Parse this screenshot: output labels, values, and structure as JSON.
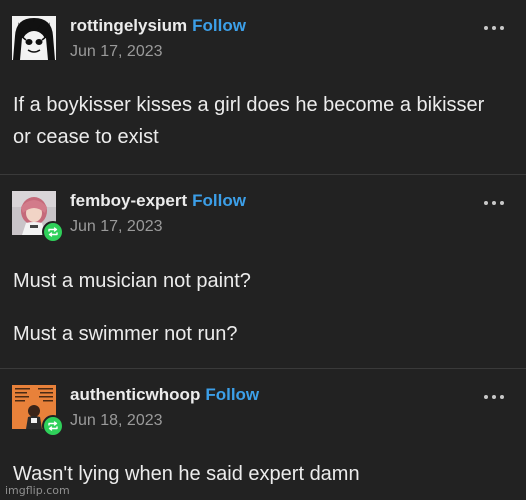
{
  "posts": [
    {
      "username": "rottingelysium",
      "follow_label": "Follow",
      "date": "Jun 17, 2023",
      "paragraphs": [
        "If a boykisser kisses a girl does he become a bikisser or cease to exist"
      ],
      "avatar": "gothic-face-avatar",
      "reblogged": false
    },
    {
      "username": "femboy-expert",
      "follow_label": "Follow",
      "date": "Jun 17, 2023",
      "paragraphs": [
        "Must a musician not paint?",
        "Must a swimmer not run?"
      ],
      "avatar": "anime-character-avatar",
      "reblogged": true
    },
    {
      "username": "authenticwhoop",
      "follow_label": "Follow",
      "date": "Jun 18, 2023",
      "paragraphs": [
        "Wasn't lying when he said expert damn"
      ],
      "avatar": "album-cover-avatar",
      "reblogged": true
    }
  ],
  "watermark": "imgflip.com",
  "colors": {
    "background": "#222222",
    "follow": "#3c9fe8",
    "reblog_badge": "#2fd05a",
    "date": "#9a9a9a"
  }
}
